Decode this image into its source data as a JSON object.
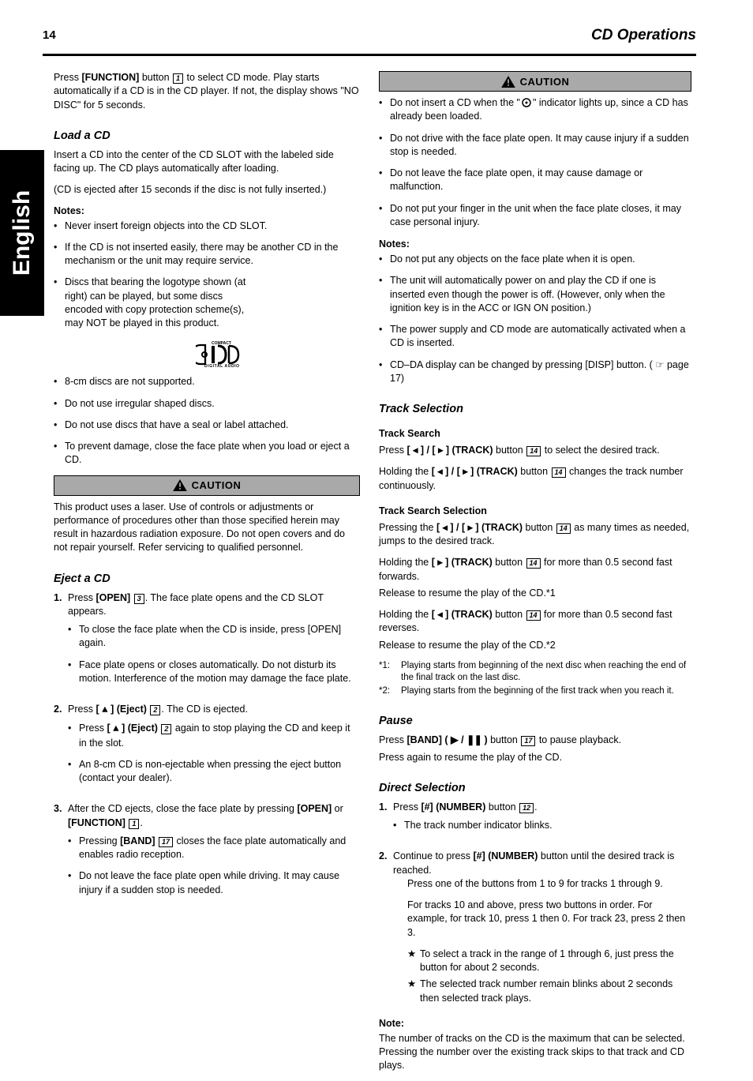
{
  "page": {
    "number": "14",
    "title": "CD Operations",
    "language_tab": "English"
  },
  "left": {
    "intro": "Press [FUNCTION] button     to select CD mode. Play starts automatically if a CD is in the CD player. If not, the display shows \"NO DISC\" for 5 seconds.",
    "intro_boxref": "1",
    "loadcd_heading": "Load a CD",
    "loadbody": "Insert a CD into the center of the CD SLOT with the labeled side facing up. The CD plays automatically after loading.",
    "loadcaution": "(CD is ejected after 15 seconds if the disc is not fully inserted.)",
    "notes_heading": "Notes:",
    "note1": "Never insert foreign objects into the CD SLOT.",
    "note2": "If the CD is not inserted easily, there may be another CD in the mechanism or the unit may require service.",
    "note3_before": "Discs that bearing the logotype shown (at right) can be played, but some discs encoded with copy protection scheme(s), may NOT be played in this product.",
    "note4": "8-cm discs are not supported.",
    "note5": "Do not use irregular shaped discs.",
    "note6": "Do not use discs that have a seal or label attached.",
    "note7": "To prevent damage, close the face plate when you load or eject a CD.",
    "caution_text": "This product uses a laser. Use of controls or adjustments or performance of procedures other than those specified herein may result in hazardous radiation exposure. Do not open covers and do not repair yourself. Refer servicing to qualified personnel.",
    "caution_label": "CAUTION",
    "ejectcd_heading": "Eject a CD",
    "eject1_before": "Press [OPEN]    . The face plate opens and the CD SLOT appears.",
    "eject1_ref": "3",
    "eject1_note1": "To close the face plate when the CD is inside, press [OPEN] again.",
    "eject1_note2": "Face plate opens or closes automatically. Do not disturb its motion. Interference of the motion may damage the face plate.",
    "eject2_before": "Press [   ] (Eject)    . The CD is ejected.",
    "eject2_ref": "2",
    "eject2_note1_a": "Press [   ] (Eject)     again to stop playing the CD and keep it in the slot.",
    "eject2_note1_b": "An 8-cm CD is non-ejectable when pressing the eject button (contact your dealer).",
    "eject2_note1_ref": "2",
    "eject3_before": "After the CD ejects, close the face plate by pressing [OPEN] or [FUNCTION]    .",
    "eject3_ref": "1",
    "eject3_after_a": "Pressing [BAND]     closes the face plate automatically and enables radio reception.",
    "eject3_ref2": "17",
    "eject3_note": "Do not leave the face plate open while driving. It may cause injury if a sudden stop is needed."
  },
  "right": {
    "caution_label": "CAUTION",
    "c1": "Do not insert a CD when the \"    \" indicator lights up, since a CD has already been loaded.",
    "c2": "Do not drive with the face plate open. It may cause injury if a sudden stop is needed.",
    "c3": "Do not leave the face plate open, it may cause damage or malfunction.",
    "c4": "Do not put your finger in the unit when the face plate closes, it may case personal injury.",
    "notes_heading": "Notes:",
    "n1": "Do not put any objects on the face plate when it is open.",
    "n2": "The unit will automatically power on and play the CD if one is inserted even though the power is off. (However, only when the ignition key is in the ACC or IGN ON position.)",
    "n3": "The power supply and CD mode are automatically activated when a CD is inserted.",
    "n4": "CD–DA display can be changed by pressing [DISP] button. ( ☞ page 17)",
    "ts_heading": "Track Selection",
    "ts_search_heading": "Track Search",
    "ts_search_a": "Press [    ] / [    ] (TRACK) button     to select the desired track.",
    "ts_search_ref": "14",
    "ts_search_b": "Holding the [    ] / [    ] (TRACK) button     changes the track number continuously.",
    "ts_search_ref2": "14",
    "tsel_heading": "Track Search Selection",
    "tsel_body": "Pressing the [    ] / [    ] (TRACK) button     as many times as needed, jumps to the desired track.",
    "tsel_ref": "14",
    "ff_a": "Holding the [    ] (TRACK) button     for more than 0.5 second fast forwards.",
    "ff_ref": "14",
    "ff_b": "Release to resume the play of the CD.*1",
    "fr_a": "Holding the [    ] (TRACK) button     for more than 0.5 second fast reverses.",
    "fr_ref": "14",
    "fr_b": "Release to resume the play of the CD.*2",
    "ann1_lab": "*1:",
    "ann1": "Playing starts from beginning of the next disc when reaching the end of the final track on the last disc.",
    "ann2_lab": "*2:",
    "ann2": "Playing starts from the beginning of the first track when you reach it.",
    "pause_heading": "Pause",
    "pause_a": "Press [BAND] (    /    ) button     to pause playback.",
    "pause_ref": "17",
    "pause_b": "Press again to resume the play of the CD.",
    "ds_heading": "Direct Selection",
    "ds1_a": "Press [#] (NUMBER) button    .",
    "ds1_ref": "12",
    "ds1_note": "The track number indicator blinks.",
    "ds2": "Continue to press [#] (NUMBER) button until the desired track is reached.",
    "ds2_sub_a": "Press one of the buttons from 1 to 9 for tracks 1 through 9.",
    "ds2_sub_b": "For tracks 10 and above, press two buttons in order. For example, for track 10, press 1 then 0. For track 23, press 2 then 3.",
    "ds2_sub_c": "To select a track in the range of 1 through 6, just press the button for about 2 seconds.",
    "ds2_sub_d": "The selected track number remain blinks about 2 seconds then selected track plays.",
    "note_heading": "Note:",
    "note_body": "The number of tracks on the CD is the maximum that can be selected. Pressing the number over the existing track skips to that track and CD plays."
  }
}
